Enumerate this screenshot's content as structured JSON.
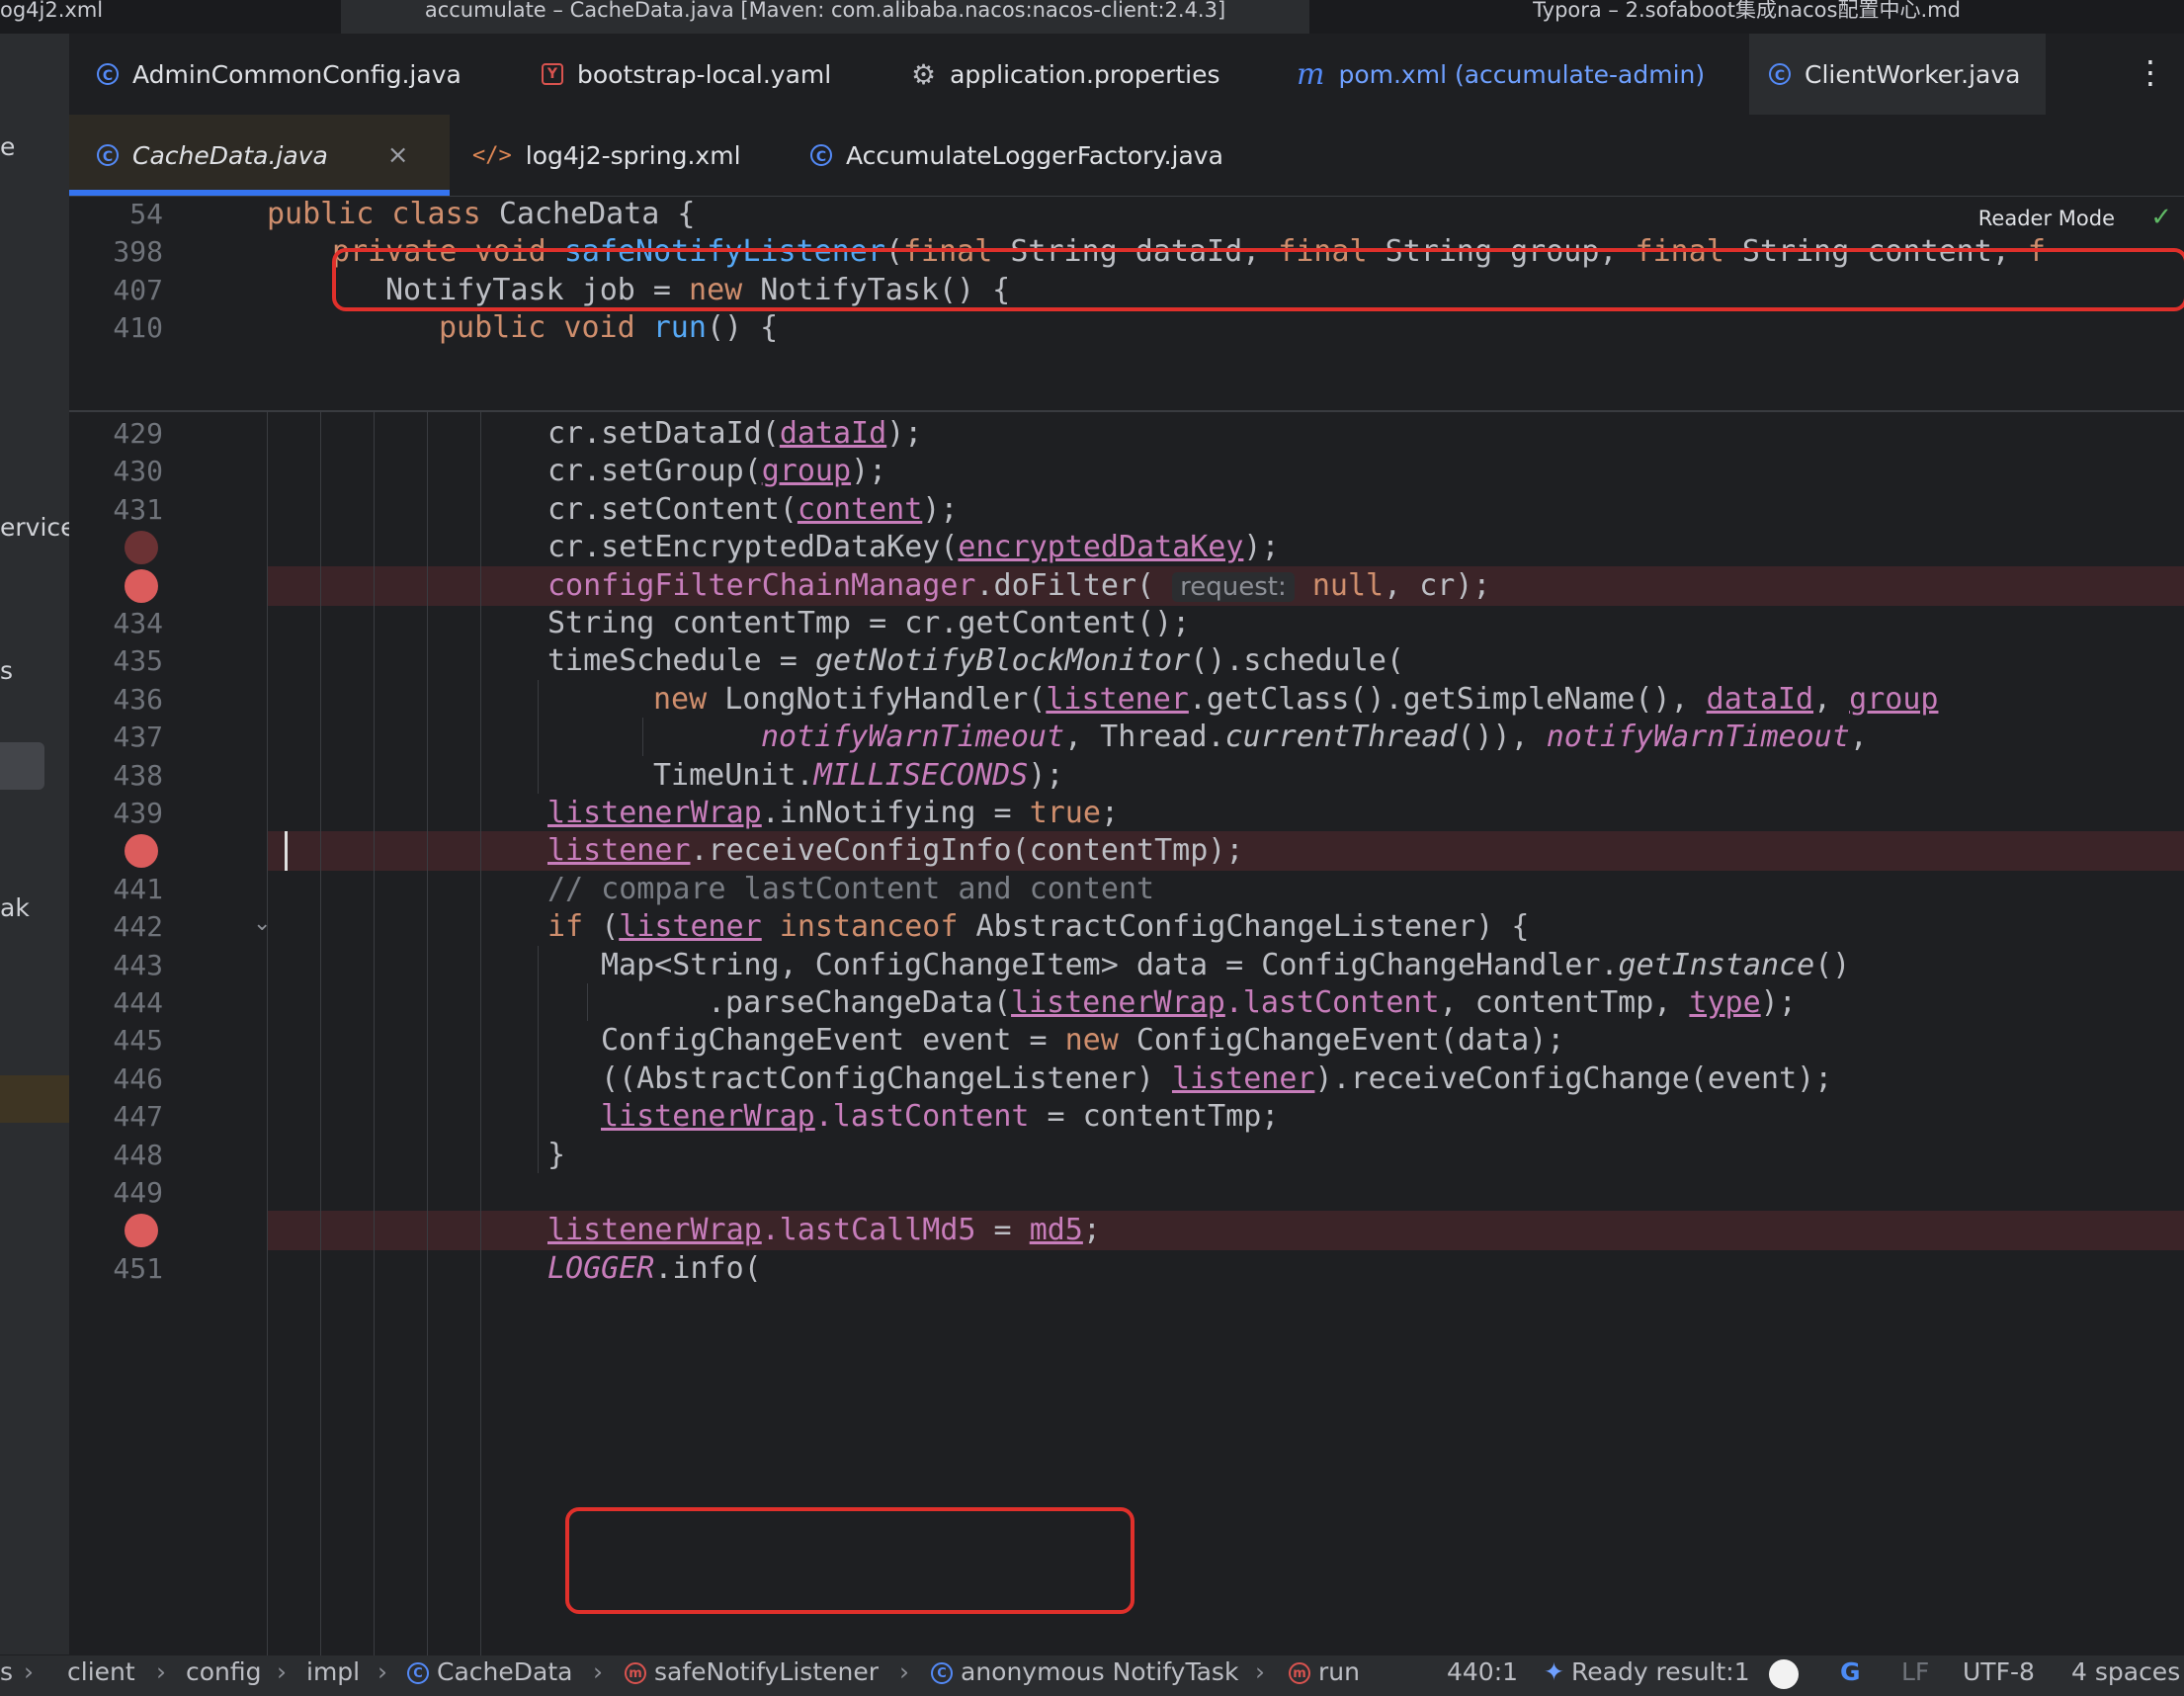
{
  "window_tabs": [
    "og4j2.xml",
    "accumulate – CacheData.java [Maven: com.alibaba.nacos:nacos-client:2.4.3]",
    "Typora – 2.sofaboot集成nacos配置中心.md"
  ],
  "left_strip": [
    "e",
    "ervice",
    "s",
    "ak"
  ],
  "editor_tabs_row1": [
    {
      "label": "AdminCommonConfig.java",
      "icon": "class-icon"
    },
    {
      "label": "bootstrap-local.yaml",
      "icon": "yaml-icon"
    },
    {
      "label": "application.properties",
      "icon": "gear-icon"
    },
    {
      "label": "pom.xml (accumulate-admin)",
      "icon": "maven-icon"
    },
    {
      "label": "ClientWorker.java",
      "icon": "class-icon"
    }
  ],
  "editor_tabs_row2": [
    {
      "label": "CacheData.java",
      "icon": "class-icon",
      "active": true
    },
    {
      "label": "log4j2-spring.xml",
      "icon": "xml-icon"
    },
    {
      "label": "AccumulateLoggerFactory.java",
      "icon": "class-icon"
    }
  ],
  "reader_mode": "Reader Mode",
  "sticky_lines": [
    {
      "n": "54",
      "tokens": [
        [
          "kw",
          "public class "
        ],
        [
          "",
          "CacheData {"
        ]
      ]
    },
    {
      "n": "398",
      "tokens": [
        [
          "kw",
          "private void "
        ],
        [
          "fn",
          "safeNotifyListener"
        ],
        [
          "",
          "("
        ],
        [
          "kw",
          "final "
        ],
        [
          "",
          "String dataId, "
        ],
        [
          "kw",
          "final "
        ],
        [
          "",
          "String group, "
        ],
        [
          "kw",
          "final "
        ],
        [
          "",
          "String content, "
        ],
        [
          "kw",
          "f"
        ]
      ]
    },
    {
      "n": "407",
      "tokens": [
        [
          "",
          "NotifyTask job = "
        ],
        [
          "kw",
          "new "
        ],
        [
          "",
          "NotifyTask() {"
        ]
      ]
    },
    {
      "n": "410",
      "tokens": [
        [
          "kw",
          "public void "
        ],
        [
          "fn",
          "run"
        ],
        [
          "",
          "() {"
        ]
      ]
    }
  ],
  "code_lines": [
    {
      "n": "429",
      "tokens": [
        [
          "",
          "cr.setDataId("
        ],
        [
          "ul",
          "dataId"
        ],
        [
          "",
          ");"
        ]
      ]
    },
    {
      "n": "430",
      "tokens": [
        [
          "",
          "cr.setGroup("
        ],
        [
          "ul",
          "group"
        ],
        [
          "",
          ");"
        ]
      ]
    },
    {
      "n": "431",
      "tokens": [
        [
          "",
          "cr.setContent("
        ],
        [
          "ul",
          "content"
        ],
        [
          "",
          ");"
        ]
      ]
    },
    {
      "n": "",
      "tokens": [
        [
          "",
          "cr.setEncryptedDataKey("
        ],
        [
          "ul",
          "encryptedDataKey"
        ],
        [
          "",
          ");"
        ]
      ]
    },
    {
      "n": "",
      "tokens": [
        [
          "fld",
          "configFilterChainManager"
        ],
        [
          "",
          ".doFilter( "
        ],
        [
          "hint",
          "request:"
        ],
        [
          "kw",
          " null"
        ],
        [
          "",
          ", cr);"
        ]
      ]
    },
    {
      "n": "434",
      "tokens": [
        [
          "",
          "String contentTmp = cr.getContent();"
        ]
      ]
    },
    {
      "n": "435",
      "tokens": [
        [
          "",
          "timeSchedule = "
        ],
        [
          "it",
          "getNotifyBlockMonitor"
        ],
        [
          "",
          "().schedule("
        ]
      ]
    },
    {
      "n": "436",
      "tokens": [
        [
          "kw",
          "new "
        ],
        [
          "",
          "LongNotifyHandler("
        ],
        [
          "ul",
          "listener"
        ],
        [
          "",
          ".getClass().getSimpleName(), "
        ],
        [
          "ul",
          "dataId"
        ],
        [
          "",
          ", "
        ],
        [
          "ul",
          "group"
        ]
      ]
    },
    {
      "n": "437",
      "tokens": [
        [
          "itf",
          "notifyWarnTimeout"
        ],
        [
          "",
          ", Thread."
        ],
        [
          "it",
          "currentThread"
        ],
        [
          "",
          "()), "
        ],
        [
          "itf",
          "notifyWarnTimeout"
        ],
        [
          "",
          ", "
        ]
      ]
    },
    {
      "n": "438",
      "tokens": [
        [
          "",
          "TimeUnit."
        ],
        [
          "itf",
          "MILLISECONDS"
        ],
        [
          "",
          ");"
        ]
      ]
    },
    {
      "n": "439",
      "tokens": [
        [
          "ul",
          "listenerWrap"
        ],
        [
          "",
          ".inNotifying = "
        ],
        [
          "kw",
          "true"
        ],
        [
          "",
          ";"
        ]
      ]
    },
    {
      "n": "",
      "tokens": [
        [
          "ul",
          "listener"
        ],
        [
          "",
          ".receiveConfigInfo(contentTmp);"
        ]
      ]
    },
    {
      "n": "441",
      "tokens": [
        [
          "cm",
          "// compare lastContent and content"
        ]
      ]
    },
    {
      "n": "442",
      "tokens": [
        [
          "kw",
          "if "
        ],
        [
          "",
          "("
        ],
        [
          "ul",
          "listener"
        ],
        [
          "kw",
          " instanceof "
        ],
        [
          "",
          "AbstractConfigChangeListener) {"
        ]
      ]
    },
    {
      "n": "443",
      "tokens": [
        [
          "",
          "Map<String, ConfigChangeItem> data = ConfigChangeHandler."
        ],
        [
          "it",
          "getInstance"
        ],
        [
          "",
          "()"
        ]
      ]
    },
    {
      "n": "444",
      "tokens": [
        [
          "",
          ".parseChangeData("
        ],
        [
          "ul",
          "listenerWrap"
        ],
        [
          "fld",
          ".lastContent"
        ],
        [
          "",
          ", contentTmp, "
        ],
        [
          "ul",
          "type"
        ],
        [
          "",
          ");"
        ]
      ]
    },
    {
      "n": "445",
      "tokens": [
        [
          "",
          "ConfigChangeEvent event = "
        ],
        [
          "kw",
          "new "
        ],
        [
          "",
          "ConfigChangeEvent(data);"
        ]
      ]
    },
    {
      "n": "446",
      "tokens": [
        [
          "",
          "((AbstractConfigChangeListener) "
        ],
        [
          "ul",
          "listener"
        ],
        [
          "",
          ").receiveConfigChange(event);"
        ]
      ]
    },
    {
      "n": "447",
      "tokens": [
        [
          "ul",
          "listenerWrap"
        ],
        [
          "fld",
          ".lastContent"
        ],
        [
          "",
          " = contentTmp;"
        ]
      ]
    },
    {
      "n": "448",
      "tokens": [
        [
          "",
          "}"
        ]
      ]
    },
    {
      "n": "449",
      "tokens": []
    },
    {
      "n": "",
      "tokens": [
        [
          "ul",
          "listenerWrap"
        ],
        [
          "fld",
          ".lastCallMd5"
        ],
        [
          "",
          " = "
        ],
        [
          "ul",
          "md5"
        ],
        [
          "",
          ";"
        ]
      ]
    },
    {
      "n": "451",
      "tokens": [
        [
          "itf",
          "LOGGER"
        ],
        [
          "",
          ".info("
        ]
      ]
    }
  ],
  "breadcrumb": [
    "s",
    "client",
    "config",
    "impl",
    "CacheData",
    "safeNotifyListener",
    "anonymous NotifyTask",
    "run"
  ],
  "status": {
    "position": "440:1",
    "ready": "Ready result:1",
    "line_sep": "LF",
    "encoding": "UTF-8",
    "indent": "4 spaces"
  },
  "colors": {
    "keyword": "#cf8e6d",
    "method": "#56a8f5",
    "field": "#c77dbb",
    "breakpoint": "#db5c5c",
    "highlight_box": "#e0302b",
    "accent": "#3574f0"
  }
}
